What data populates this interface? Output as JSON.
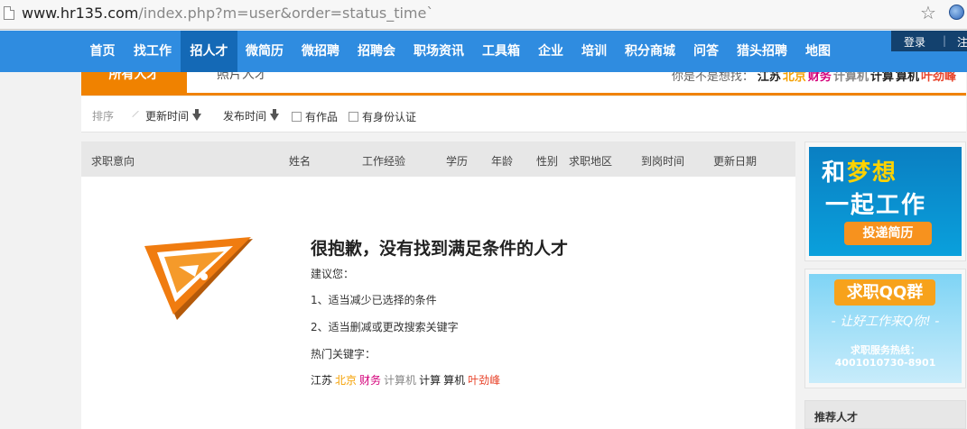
{
  "browser": {
    "url_host": "www.hr135.com",
    "url_path": "/index.php?m=user&order=status_time`"
  },
  "nav": {
    "items": [
      "首页",
      "找工作",
      "招人才",
      "微简历",
      "微招聘",
      "招聘会",
      "职场资讯",
      "工具箱",
      "企业",
      "培训",
      "积分商城",
      "问答",
      "猎头招聘",
      "地图"
    ],
    "active_index": 2,
    "login": "登录",
    "register": "注"
  },
  "tabs": {
    "all": "所有人才",
    "photo": "照片人才"
  },
  "suggest": {
    "lead": "你是不是想找：",
    "words": [
      {
        "text": "江苏",
        "color": "#222222"
      },
      {
        "text": "北京",
        "color": "#f5a000"
      },
      {
        "text": "财务",
        "color": "#d4007a"
      },
      {
        "text": "计算机",
        "color": "#888888"
      },
      {
        "text": "计算",
        "color": "#222222"
      },
      {
        "text": "算机",
        "color": "#222222"
      },
      {
        "text": "叶劲峰",
        "color": "#e8452c"
      }
    ]
  },
  "sortbar": {
    "label": "排序",
    "update_time": "更新时间",
    "publish_time": "发布时间",
    "has_works": "有作品",
    "verified": "有身份认证"
  },
  "table": {
    "headers": [
      "求职意向",
      "姓名",
      "工作经验",
      "学历",
      "年龄",
      "性别",
      "求职地区",
      "到岗时间",
      "更新日期"
    ]
  },
  "empty": {
    "title": "很抱歉，没有找到满足条件的人才",
    "advice": "建议您：",
    "tip1": "1、适当减少已选择的条件",
    "tip2": "2、适当删减或更改搜索关键字",
    "hot_label": "热门关键字：",
    "hot_words": [
      {
        "text": "江苏",
        "color": "#222222"
      },
      {
        "text": "北京",
        "color": "#f5a000"
      },
      {
        "text": "财务",
        "color": "#d4007a"
      },
      {
        "text": "计算机",
        "color": "#888888"
      },
      {
        "text": "计算",
        "color": "#222222"
      },
      {
        "text": "算机",
        "color": "#222222"
      },
      {
        "text": "叶劲峰",
        "color": "#e8452c"
      }
    ]
  },
  "sidebar": {
    "ad1_line1_a": "和",
    "ad1_line1_b": "梦想",
    "ad1_line2": "一起工作",
    "ad1_button": "投递简历",
    "ad2_title": "求职QQ群",
    "ad2_slogan": "- 让好工作来Q你! -",
    "ad2_hotline_label": "求职服务热线：",
    "ad2_hotline": "4001010730-8901",
    "recommend": "推荐人才"
  },
  "colors": {
    "nav_blue": "#2f8ce0",
    "nav_active": "#1469b6",
    "accent_orange": "#f08200"
  }
}
